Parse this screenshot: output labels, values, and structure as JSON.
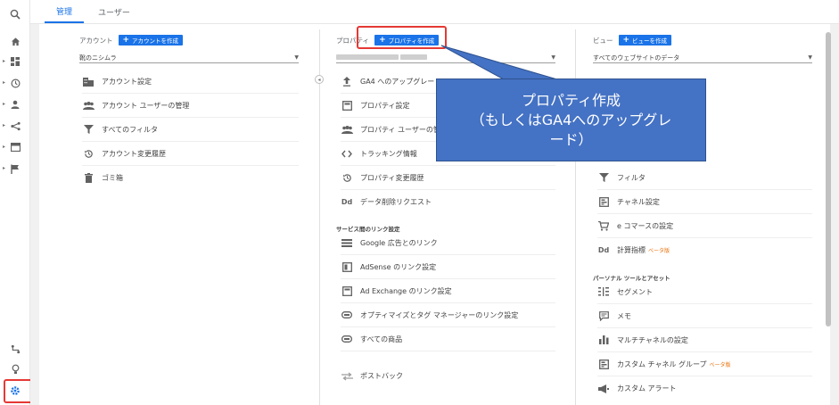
{
  "tabs": {
    "admin": "管理",
    "user": "ユーザー"
  },
  "account": {
    "label": "アカウント",
    "create": "アカウントを作成",
    "selected": "靴のニシムラ",
    "items": [
      {
        "label": "アカウント設定",
        "icon": "building-icon"
      },
      {
        "label": "アカウント ユーザーの管理",
        "icon": "people-icon"
      },
      {
        "label": "すべてのフィルタ",
        "icon": "filter-icon"
      },
      {
        "label": "アカウント変更履歴",
        "icon": "history-icon"
      },
      {
        "label": "ゴミ箱",
        "icon": "trash-icon"
      }
    ]
  },
  "property": {
    "label": "プロパティ",
    "create": "プロパティを作成",
    "items": [
      {
        "label": "GA4 へのアップグレード",
        "icon": "upload-icon"
      },
      {
        "label": "プロパティ設定",
        "icon": "square-icon"
      },
      {
        "label": "プロパティ ユーザーの管",
        "icon": "people-icon"
      },
      {
        "label": "トラッキング情報",
        "icon": "code-icon"
      },
      {
        "label": "プロパティ変更履歴",
        "icon": "history-icon"
      },
      {
        "label": "データ削除リクエスト",
        "icon": "dd-icon",
        "glyph": "Dd"
      }
    ],
    "section": "サービス間のリンク設定",
    "links": [
      {
        "label": "Google 広告とのリンク",
        "icon": "ads-icon"
      },
      {
        "label": "AdSense のリンク設定",
        "icon": "adsense-icon"
      },
      {
        "label": "Ad Exchange のリンク設定",
        "icon": "square-icon"
      },
      {
        "label": "オプティマイズとタグ マネージャーのリンク設定",
        "icon": "link-icon"
      },
      {
        "label": "すべての商品",
        "icon": "link-icon"
      },
      {
        "label": "ポストバック",
        "icon": "swap-icon"
      }
    ]
  },
  "view": {
    "label": "ビュー",
    "create": "ビューを作成",
    "selected": "すべてのウェブサイトのデータ",
    "items": [
      {
        "label": "フィルタ",
        "icon": "filter-icon"
      },
      {
        "label": "チャネル設定",
        "icon": "channel-icon"
      },
      {
        "label": "e コマースの設定",
        "icon": "cart-icon"
      },
      {
        "label": "計算指標",
        "icon": "dd-icon",
        "glyph": "Dd",
        "beta": "ベータ版"
      }
    ],
    "section": "パーソナル ツールとアセット",
    "tools": [
      {
        "label": "セグメント",
        "icon": "segment-icon"
      },
      {
        "label": "メモ",
        "icon": "note-icon"
      },
      {
        "label": "マルチチャネルの設定",
        "icon": "bar-icon"
      },
      {
        "label": "カスタム チャネル グループ",
        "icon": "channel-icon",
        "beta": "ベータ版"
      },
      {
        "label": "カスタム アラート",
        "icon": "megaphone-icon"
      }
    ]
  },
  "callout": {
    "line1": "プロパティ作成",
    "line2": "（もしくはGA4へのアップグレ",
    "line3": "ード）"
  },
  "colors": {
    "accent": "#1a73e8",
    "highlight": "#e53935",
    "callout": "#4472c4"
  }
}
